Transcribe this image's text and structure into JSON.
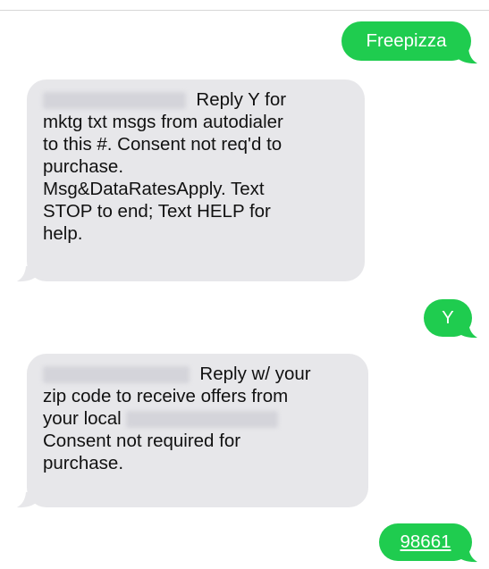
{
  "messages": [
    {
      "direction": "outgoing",
      "text": "Freepizza"
    },
    {
      "direction": "incoming",
      "lines": [
        "Reply Y for",
        "mktg txt msgs from autodialer",
        "to this #. Consent not req'd to",
        "purchase.",
        "Msg&DataRatesApply. Text",
        "STOP to end; Text HELP for",
        "help."
      ]
    },
    {
      "direction": "outgoing",
      "text": "Y"
    },
    {
      "direction": "incoming",
      "lines": [
        "Reply w/ your",
        "zip code to receive offers from",
        "your local",
        "Consent not required for",
        "purchase."
      ]
    },
    {
      "direction": "outgoing",
      "text": "98661",
      "is_link": true
    }
  ],
  "colors": {
    "outgoing_bubble": "#1fcc4f",
    "incoming_bubble": "#e7e7ea",
    "outgoing_text": "#ffffff",
    "incoming_text": "#111111"
  }
}
